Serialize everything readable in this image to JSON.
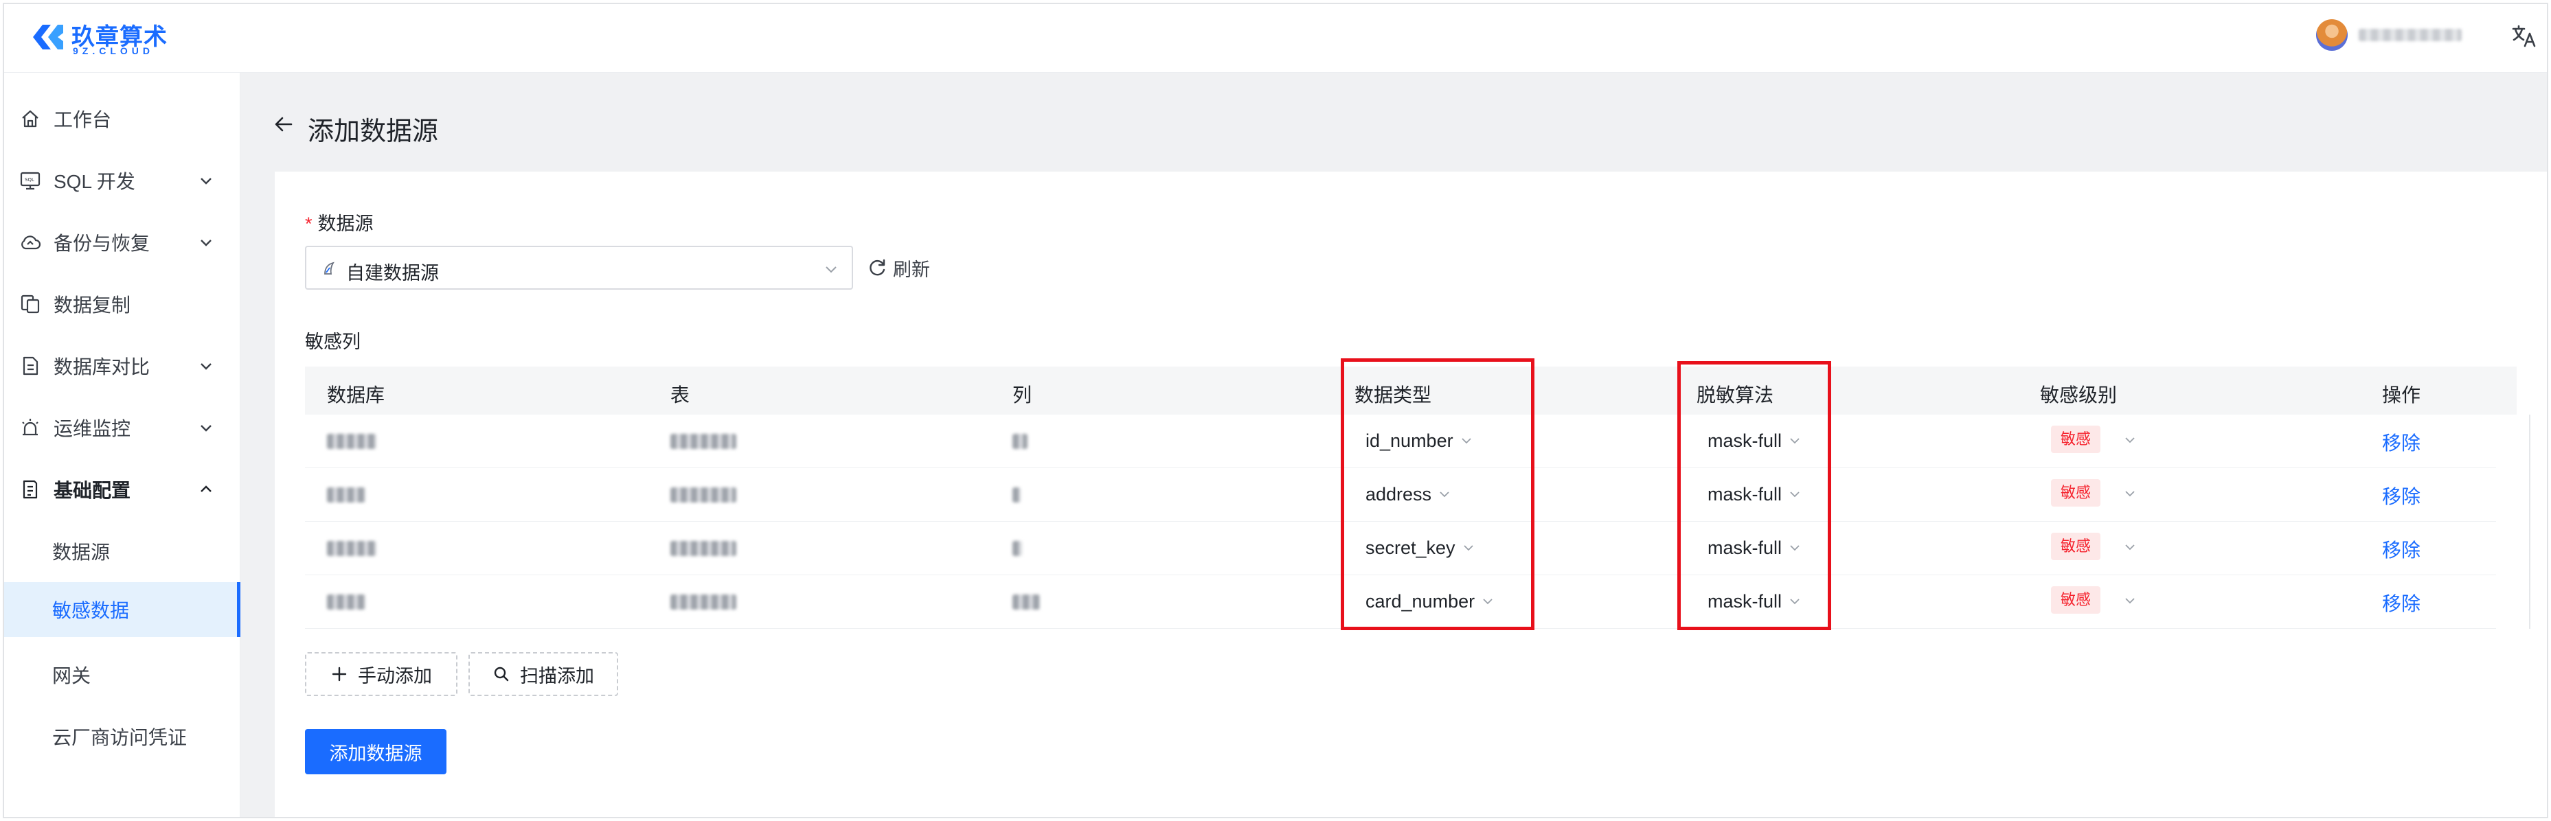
{
  "brand": {
    "name": "玖章算术",
    "sub": "9Z.CLOUD"
  },
  "sidebar": {
    "items": [
      {
        "label": "工作台"
      },
      {
        "label": "SQL 开发"
      },
      {
        "label": "备份与恢复"
      },
      {
        "label": "数据复制"
      },
      {
        "label": "数据库对比"
      },
      {
        "label": "运维监控"
      },
      {
        "label": "基础配置"
      }
    ],
    "sub_items": [
      {
        "label": "数据源"
      },
      {
        "label": "敏感数据"
      },
      {
        "label": "网关"
      },
      {
        "label": "云厂商访问凭证"
      }
    ],
    "active_sub_item": "敏感数据"
  },
  "page": {
    "title": "添加数据源"
  },
  "form": {
    "datasource_label": "数据源",
    "datasource_value": "自建数据源",
    "refresh_label": "刷新",
    "sensitive_columns_label": "敏感列"
  },
  "table": {
    "headers": [
      "数据库",
      "表",
      "列",
      "数据类型",
      "脱敏算法",
      "敏感级别",
      "操作"
    ],
    "rows": [
      {
        "data_type": "id_number",
        "algorithm": "mask-full",
        "level": "敏感",
        "action": "移除"
      },
      {
        "data_type": "address",
        "algorithm": "mask-full",
        "level": "敏感",
        "action": "移除"
      },
      {
        "data_type": "secret_key",
        "algorithm": "mask-full",
        "level": "敏感",
        "action": "移除"
      },
      {
        "data_type": "card_number",
        "algorithm": "mask-full",
        "level": "敏感",
        "action": "移除"
      }
    ]
  },
  "buttons": {
    "manual_add": "手动添加",
    "scan_add": "扫描添加",
    "submit": "添加数据源"
  },
  "colors": {
    "primary": "#1a6cff",
    "danger": "#f5222d",
    "highlight": "#e8101b"
  }
}
